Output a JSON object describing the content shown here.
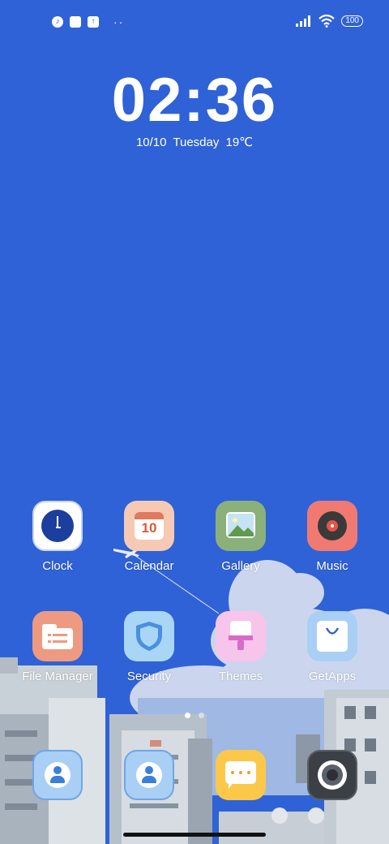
{
  "status_bar": {
    "notification_icons": [
      "tiktok-icon",
      "square-icon",
      "upload-icon"
    ],
    "more_dots": "··",
    "battery": "100"
  },
  "lockclock": {
    "time": "02:36",
    "date": "10/10  Tuesday  19℃"
  },
  "apps": [
    {
      "label": "Clock"
    },
    {
      "label": "Calendar",
      "calendar_day": "10"
    },
    {
      "label": "Gallery"
    },
    {
      "label": "Music"
    },
    {
      "label": "File Manager"
    },
    {
      "label": "Security"
    },
    {
      "label": "Themes"
    },
    {
      "label": "GetApps"
    }
  ],
  "dock": [
    {
      "name": "phone"
    },
    {
      "name": "contacts"
    },
    {
      "name": "messaging"
    },
    {
      "name": "camera"
    }
  ],
  "pagination": {
    "pages": 2,
    "current": 1
  },
  "colors": {
    "background": "#2f62d6",
    "cloud": "#cdd7f0",
    "building": "#b8c2cc"
  }
}
